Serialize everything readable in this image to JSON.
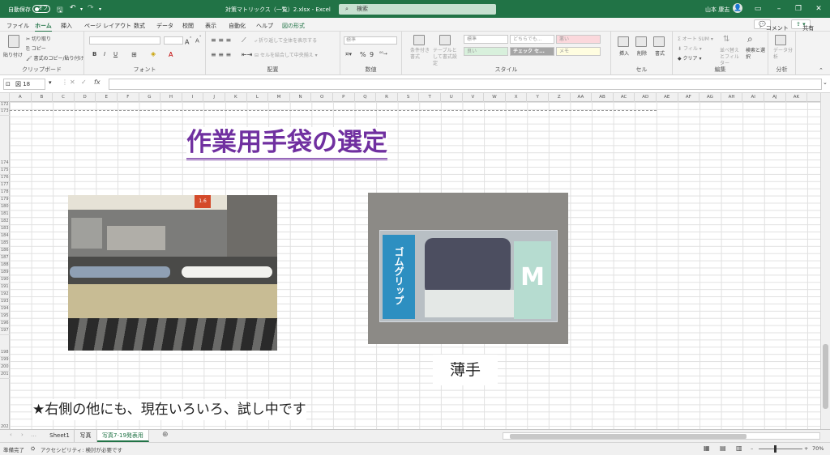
{
  "titlebar": {
    "autosave_label": "自動保存",
    "autosave_state": "オフ",
    "filename": "対策マトリックス（一覧）2.xlsx - Excel",
    "search_placeholder": "検索",
    "user_name": "山本 康志",
    "colors": {
      "bar": "#217346"
    }
  },
  "tabs": [
    "ファイル",
    "ホーム",
    "挿入",
    "ページ レイアウト",
    "数式",
    "データ",
    "校閲",
    "表示",
    "自動化",
    "ヘルプ",
    "図の形式"
  ],
  "active_tab": "ホーム",
  "share": {
    "comment_label": "コメント",
    "share_label": "共有"
  },
  "ribbon": {
    "clipboard": {
      "label": "クリップボード",
      "paste": "貼り付け",
      "cut": "切り取り",
      "copy": "コピー",
      "format_painter": "書式のコピー/貼り付け"
    },
    "font": {
      "label": "フォント"
    },
    "alignment": {
      "label": "配置",
      "wrap": "折り返して全体を表示する",
      "merge": "セルを結合して中央揃え"
    },
    "number": {
      "label": "数値",
      "format": "標準"
    },
    "styles": {
      "label": "スタイル",
      "conditional": "条件付き書式",
      "table": "テーブルとして書式設定",
      "cells": [
        "標準",
        "どちらでも...",
        "悪い",
        "良い",
        "チェック セ...",
        "メモ"
      ]
    },
    "cells": {
      "label": "セル",
      "insert": "挿入",
      "delete": "削除",
      "format": "書式"
    },
    "editing": {
      "label": "編集",
      "autosum": "オート SUM",
      "fill": "フィル",
      "clear": "クリア",
      "sort": "並べ替えとフィルター",
      "find": "検索と選択"
    },
    "analysis": {
      "label": "分析",
      "analyze": "データ分析"
    }
  },
  "formula_bar": {
    "name_box": "図 18",
    "content": ""
  },
  "columns": [
    "A",
    "B",
    "C",
    "D",
    "E",
    "F",
    "G",
    "H",
    "I",
    "J",
    "K",
    "L",
    "M",
    "N",
    "O",
    "P",
    "Q",
    "R",
    "S",
    "T",
    "U",
    "V",
    "W",
    "X",
    "Y",
    "Z",
    "AA",
    "AB",
    "AC",
    "AD",
    "AE",
    "AF",
    "AG",
    "AH",
    "AI",
    "AJ",
    "AK"
  ],
  "rows": [
    "172",
    "173",
    "174",
    "175",
    "176",
    "177",
    "178",
    "179",
    "180",
    "181",
    "182",
    "183",
    "184",
    "185",
    "186",
    "187",
    "188",
    "189",
    "190",
    "191",
    "192",
    "193",
    "194",
    "195",
    "196",
    "197",
    "198",
    "199",
    "200",
    "201",
    "202"
  ],
  "content": {
    "title": "作業用手袋の選定",
    "photo1_label": "1.6",
    "photo2_package_text": "ゴムグリップ",
    "photo2_size": "M",
    "caption": "薄手",
    "note": "★右側の他にも、現在いろいろ、試し中です"
  },
  "sheets": [
    "Sheet1",
    "写真",
    "写真7-19発表用"
  ],
  "active_sheet": "写真7-19発表用",
  "status": {
    "ready": "準備完了",
    "accessibility": "アクセシビリティ: 検討が必要です",
    "zoom": "70%"
  }
}
